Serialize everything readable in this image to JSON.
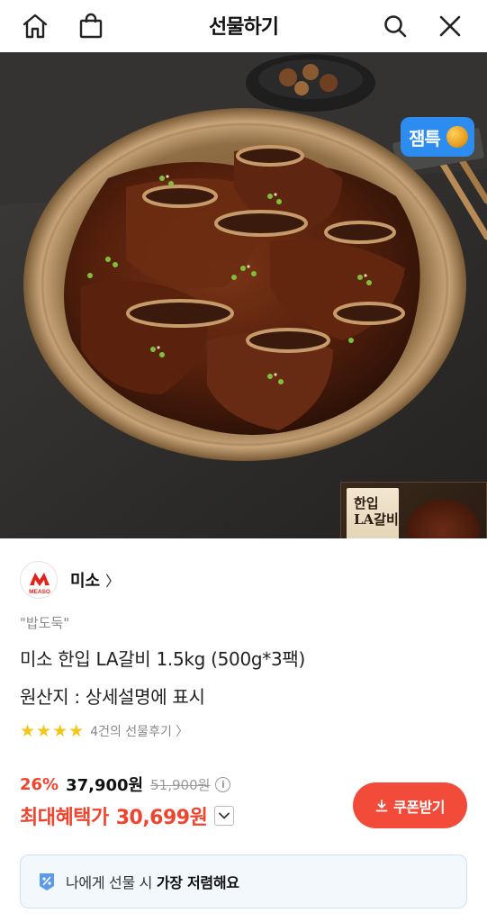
{
  "header": {
    "title": "선물하기",
    "left_icons": [
      "home-icon",
      "shopping-bag-icon"
    ],
    "right_icons": [
      "search-icon",
      "close-icon"
    ]
  },
  "hero": {
    "badge_label": "잼특",
    "package_title": "한입\nLA갈비"
  },
  "seller": {
    "logo_text": "MEASO",
    "name": "미소",
    "chevron": "〉"
  },
  "product": {
    "tagline": "\"밥도둑\"",
    "name": "미소 한입 LA갈비 1.5kg (500g*3팩)",
    "origin": "원산지 : 상세설명에 표시",
    "rating_stars": 4,
    "reviews_label": "4건의 선물후기 〉"
  },
  "pricing": {
    "discount": "26%",
    "price": "37,900원",
    "original_price": "51,900원",
    "info_icon": "i",
    "max_benefit_label": "최대혜택가",
    "max_benefit_price": "30,699원"
  },
  "coupon_button": {
    "label": "쿠폰받기"
  },
  "gift_banner": {
    "text_prefix": "나에게 선물 시",
    "text_bold": "가장 저렴해요"
  },
  "colors": {
    "accent_red": "#f0442e",
    "coupon_button": "#f24b3a",
    "badge_blue": "#2d8cf0",
    "star": "#f5c518",
    "gift_box_bg": "#f3f8fd"
  }
}
